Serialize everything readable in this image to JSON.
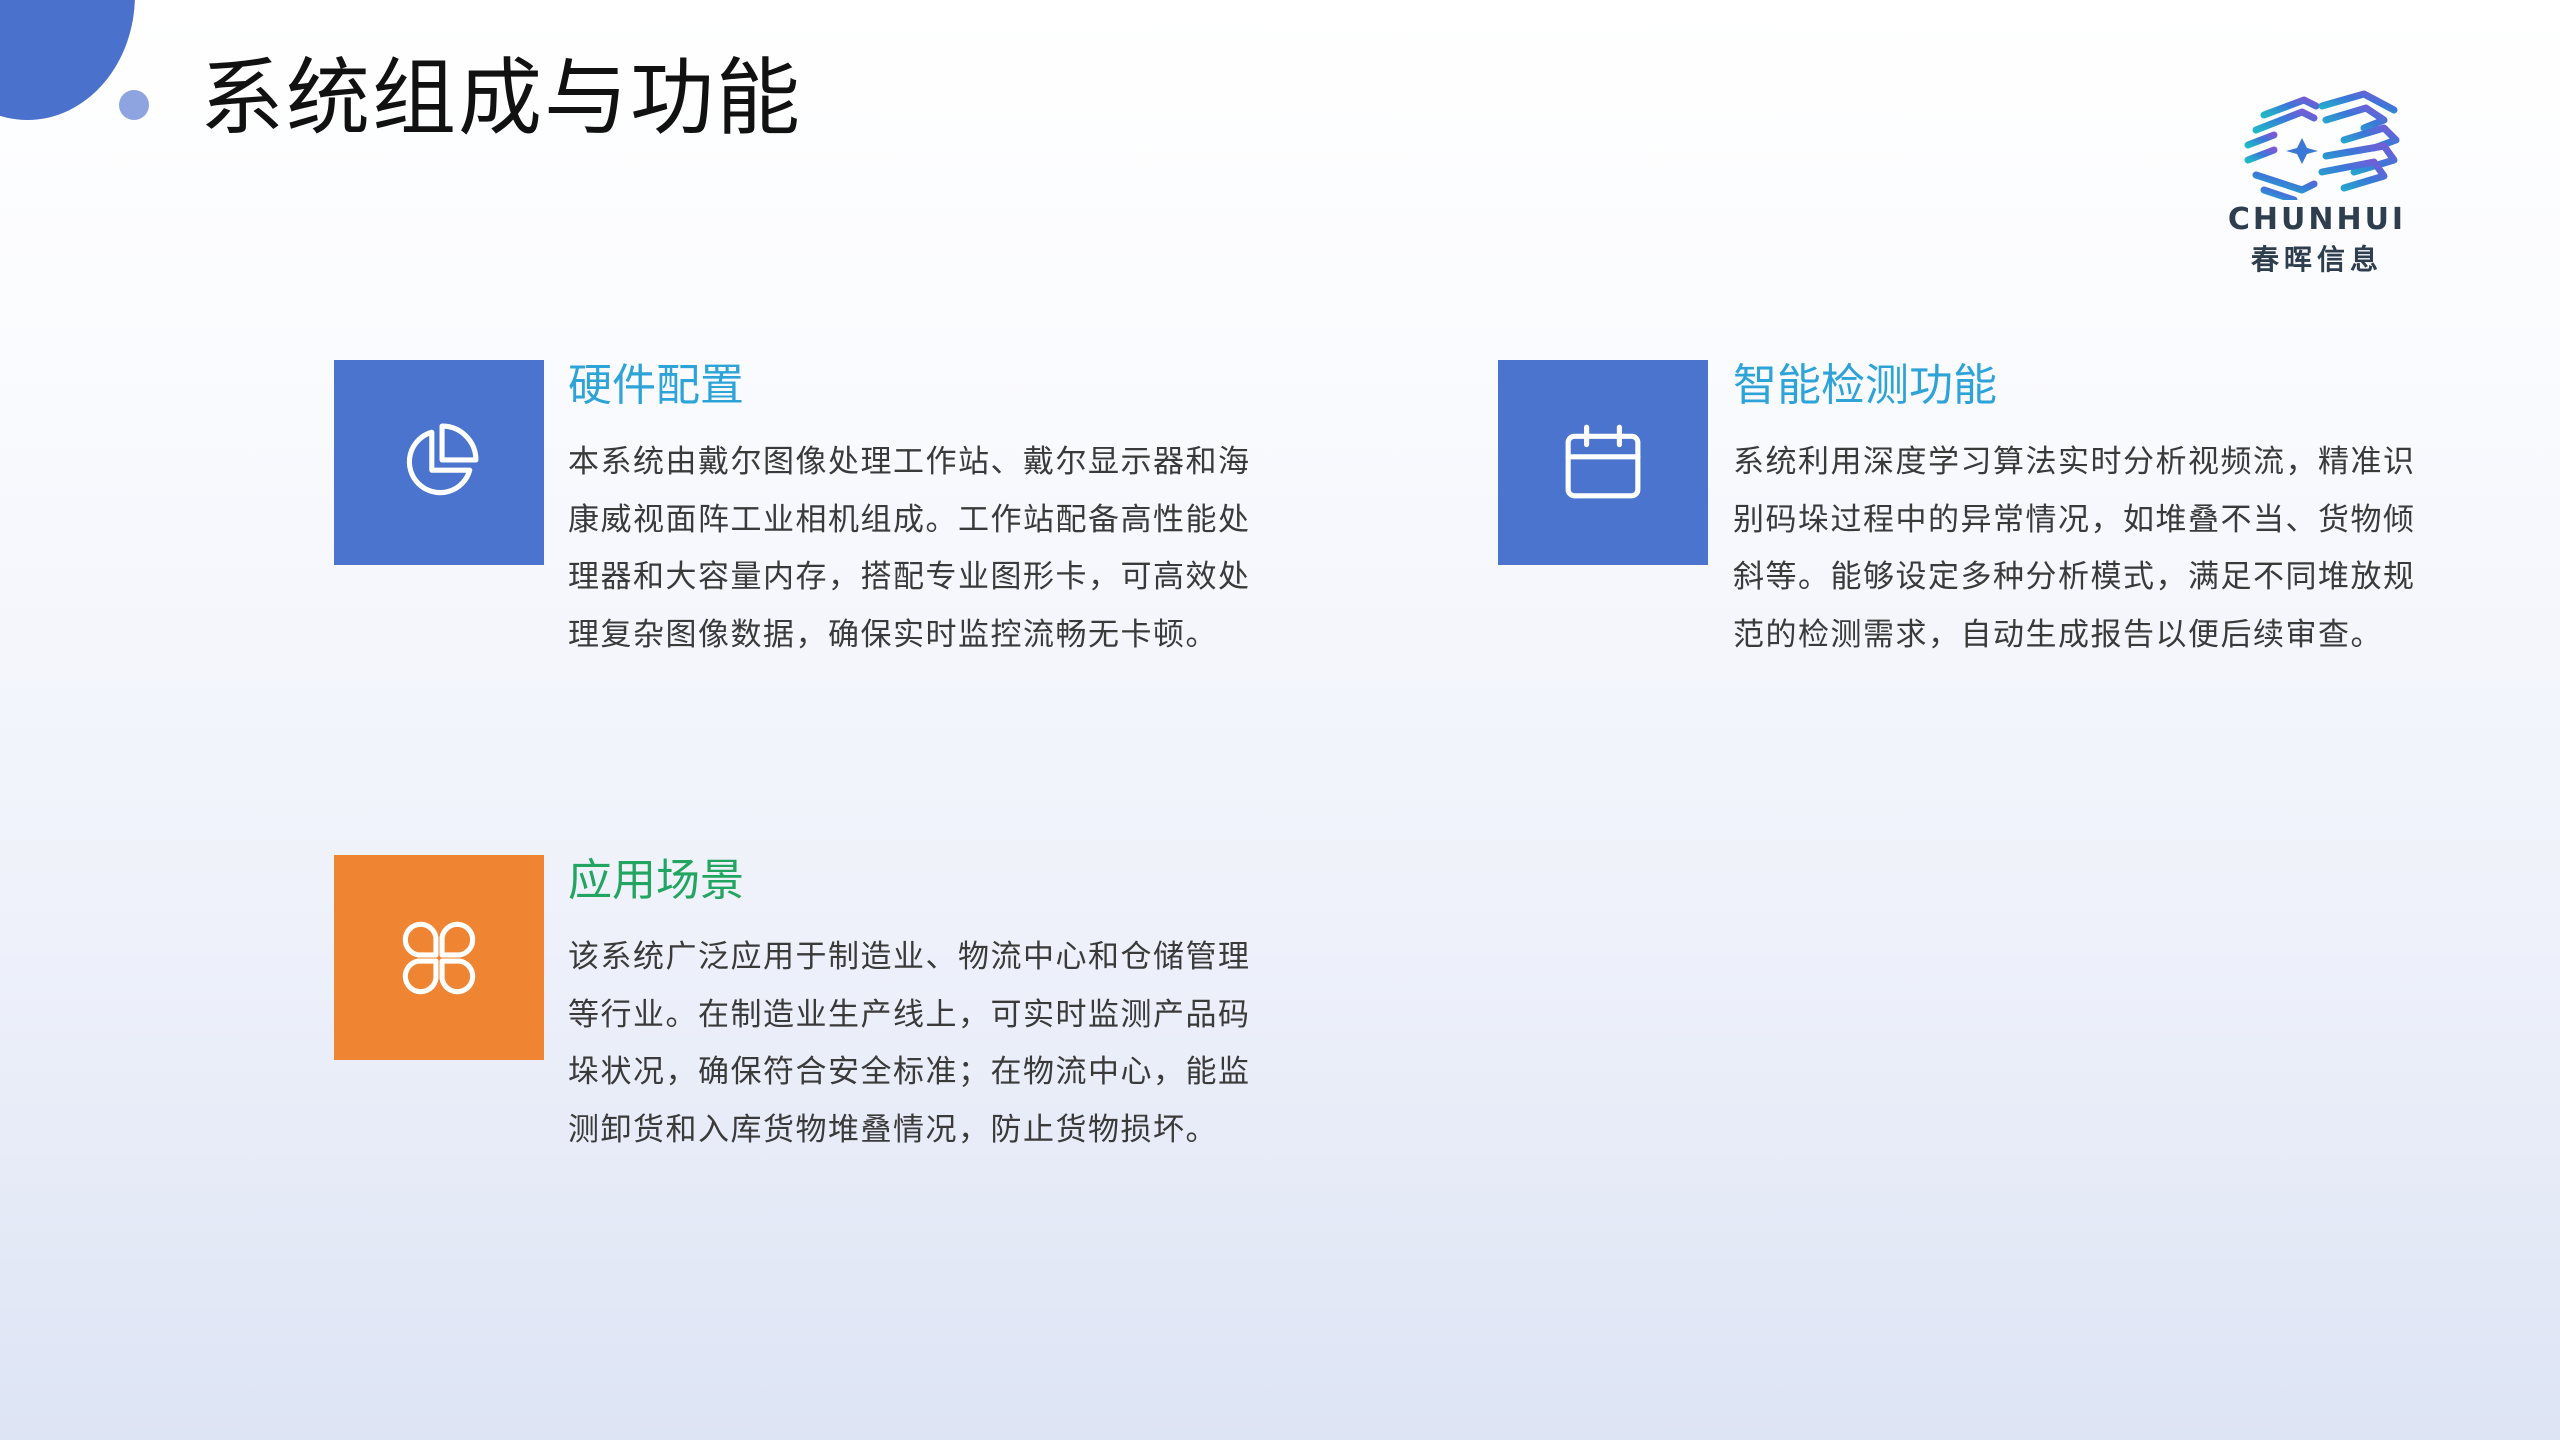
{
  "page": {
    "title": "系统组成与功能"
  },
  "logo": {
    "name_en": "CHUNHUI",
    "name_cn": "春晖信息",
    "colors": [
      "#1fb7c8",
      "#3a78d8",
      "#7a5ad6"
    ]
  },
  "cards": [
    {
      "icon": "pie-chart-icon",
      "icon_color": "#4a74cd",
      "title": "硬件配置",
      "title_color": "#2da3d8",
      "body": "本系统由戴尔图像处理工作站、戴尔显示器和海康威视面阵工业相机组成。工作站配备高性能处理器和大容量内存，搭配专业图形卡，可高效处理复杂图像数据，确保实时监控流畅无卡顿。"
    },
    {
      "icon": "calendar-icon",
      "icon_color": "#4a74cd",
      "title": "智能检测功能",
      "title_color": "#2da3d8",
      "body": "系统利用深度学习算法实时分析视频流，精准识别码垛过程中的异常情况，如堆叠不当、货物倾斜等。能够设定多种分析模式，满足不同堆放规范的检测需求，自动生成报告以便后续审查。"
    },
    {
      "icon": "four-petal-grid-icon",
      "icon_color": "#ef8432",
      "title": "应用场景",
      "title_color": "#22a560",
      "body": "该系统广泛应用于制造业、物流中心和仓储管理等行业。在制造业生产线上，可实时监测产品码垛状况，确保符合安全标准；在物流中心，能监测卸货和入库货物堆叠情况，防止货物损坏。"
    }
  ]
}
